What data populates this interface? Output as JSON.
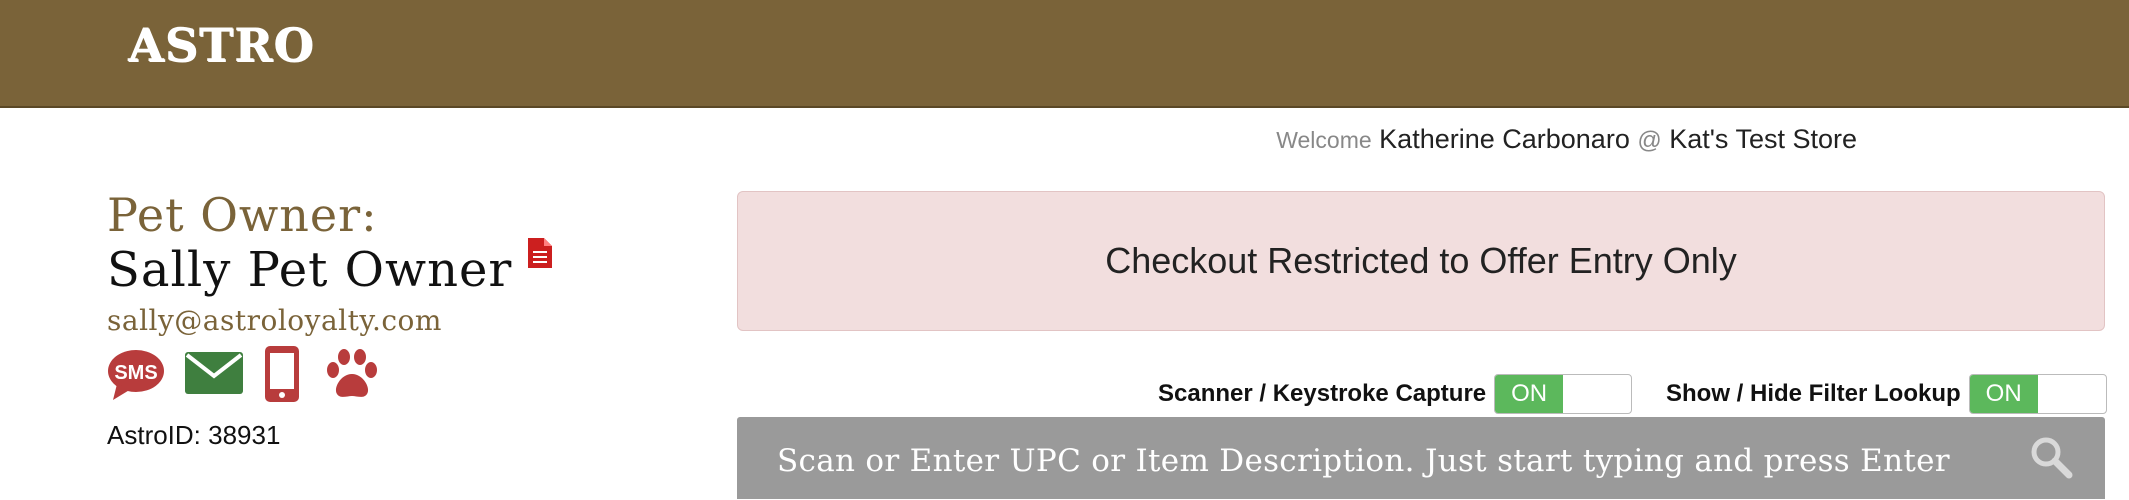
{
  "header": {
    "logo_text": "ASTRO"
  },
  "welcome": {
    "prefix": "Welcome",
    "user_name": "Katherine Carbonaro",
    "at": "@",
    "store_name": "Kat's Test Store"
  },
  "owner": {
    "heading": "Pet Owner:",
    "name": "Sally Pet Owner",
    "email": "sally@astroloyalty.com",
    "astro_id_label": "AstroID: 38931",
    "icons": [
      "sms-icon",
      "email-icon",
      "mobile-phone-icon",
      "paw-icon"
    ],
    "sms_text": "SMS"
  },
  "alert": {
    "message": "Checkout Restricted to Offer Entry Only"
  },
  "toggles": {
    "scanner_label": "Scanner / Keystroke Capture",
    "scanner_state": "ON",
    "filter_label": "Show / Hide Filter Lookup",
    "filter_state": "ON"
  },
  "search": {
    "placeholder": "Scan or Enter UPC or Item Description. Just start typing and press Enter"
  },
  "colors": {
    "brand": "#7a6339",
    "alert_bg": "#f2dede",
    "toggle_on": "#5cb85c",
    "icon_red": "#b83c3c",
    "icon_green": "#3f7f3f",
    "search_bg": "#9a9a9a"
  }
}
